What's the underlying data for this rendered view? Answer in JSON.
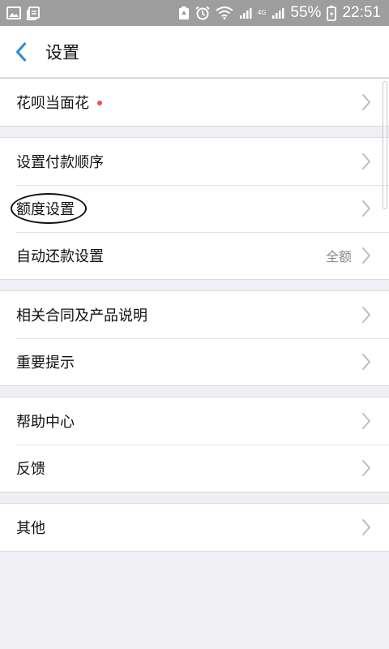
{
  "status_bar": {
    "battery_text": "55%",
    "time": "22:51",
    "network_label": "4G"
  },
  "header": {
    "title": "设置"
  },
  "groups": [
    {
      "items": [
        {
          "label": "花呗当面花",
          "has_dot": true
        }
      ]
    },
    {
      "items": [
        {
          "label": "设置付款顺序"
        },
        {
          "label": "额度设置",
          "circled": true
        },
        {
          "label": "自动还款设置",
          "value": "全额"
        }
      ]
    },
    {
      "items": [
        {
          "label": "相关合同及产品说明"
        },
        {
          "label": "重要提示"
        }
      ]
    },
    {
      "items": [
        {
          "label": "帮助中心"
        },
        {
          "label": "反馈"
        }
      ]
    },
    {
      "items": [
        {
          "label": "其他"
        }
      ]
    }
  ],
  "colors": {
    "accent": "#2a8ad4",
    "status_bar": "#9e9e9e",
    "background": "#efeff4",
    "dot": "#e8505b"
  }
}
